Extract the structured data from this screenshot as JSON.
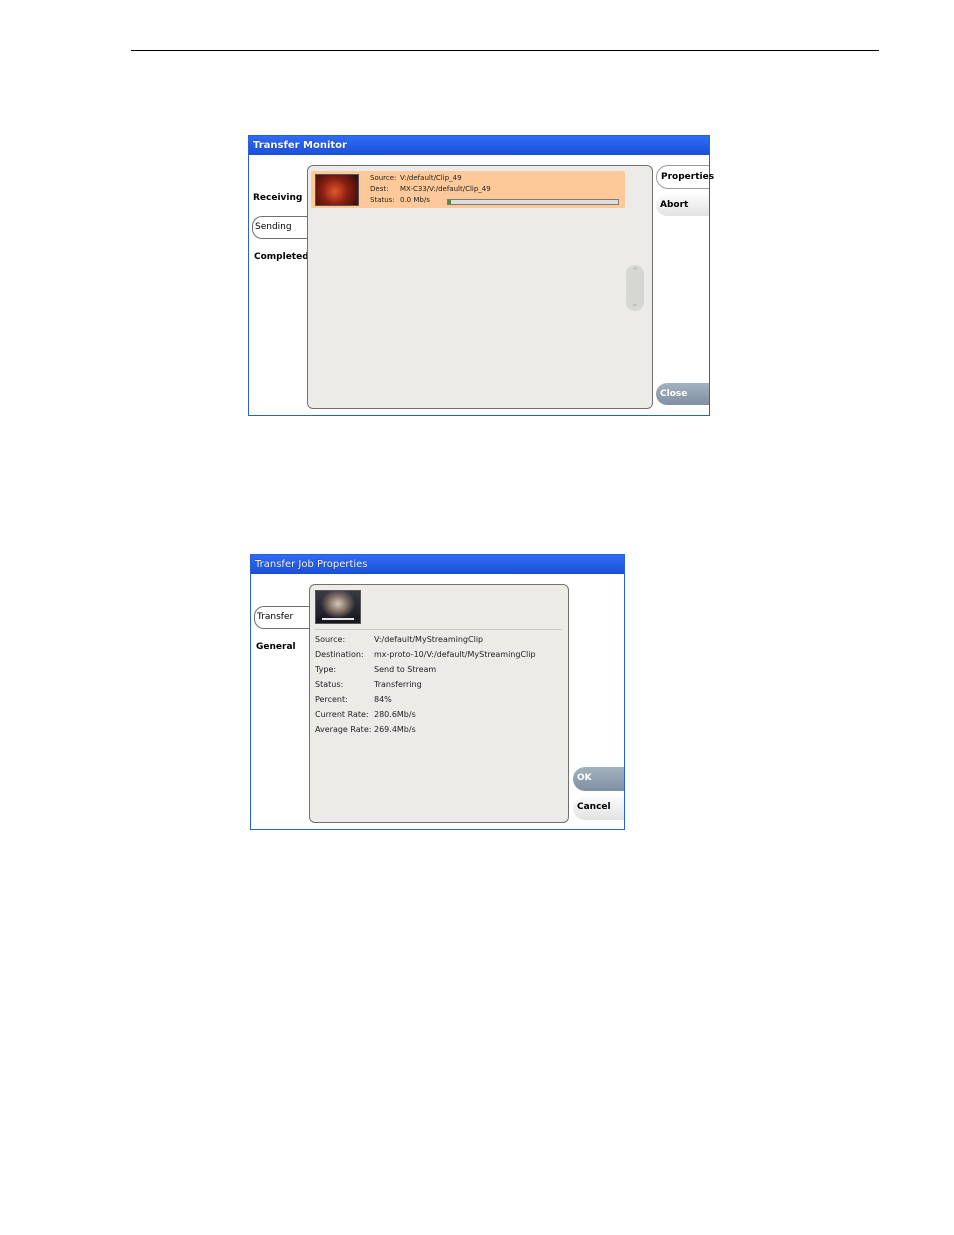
{
  "transfer_monitor": {
    "title": "Transfer Monitor",
    "tabs": [
      {
        "label": "Receiving"
      },
      {
        "label": "Sending"
      },
      {
        "label": "Completed"
      }
    ],
    "job": {
      "source_label": "Source:",
      "source_value": "V:/default/Clip_49",
      "dest_label": "Dest:",
      "dest_value": "MX-C33/V:/default/Clip_49",
      "status_label": "Status:",
      "status_value": "0.0 Mb/s",
      "progress_fraction": 0.02
    },
    "buttons": {
      "properties": "Properties",
      "abort": "Abort",
      "close": "Close"
    },
    "scroll_icons": {
      "up": "chevron-up-icon",
      "down": "chevron-down-icon"
    }
  },
  "transfer_job_properties": {
    "title": "Transfer Job Properties",
    "tabs": [
      {
        "label": "Transfer"
      },
      {
        "label": "General"
      }
    ],
    "fields": [
      {
        "label": "Source:",
        "value": "V:/default/MyStreamingClip"
      },
      {
        "label": "Destination:",
        "value": "mx-proto-10/V:/default/MyStreamingClip"
      },
      {
        "label": "Type:",
        "value": "Send to Stream"
      },
      {
        "label": "Status:",
        "value": "Transferring"
      },
      {
        "label": "Percent:",
        "value": "84%"
      },
      {
        "label": "Current Rate:",
        "value": "280.6Mb/s"
      },
      {
        "label": "Average Rate:",
        "value": "269.4Mb/s"
      }
    ],
    "buttons": {
      "ok": "OK",
      "cancel": "Cancel"
    }
  },
  "colors": {
    "title_bar": "#1f5ae0",
    "job_highlight": "#fdc999",
    "panel": "#ecebe8",
    "primary_button": "#8b9bad"
  }
}
